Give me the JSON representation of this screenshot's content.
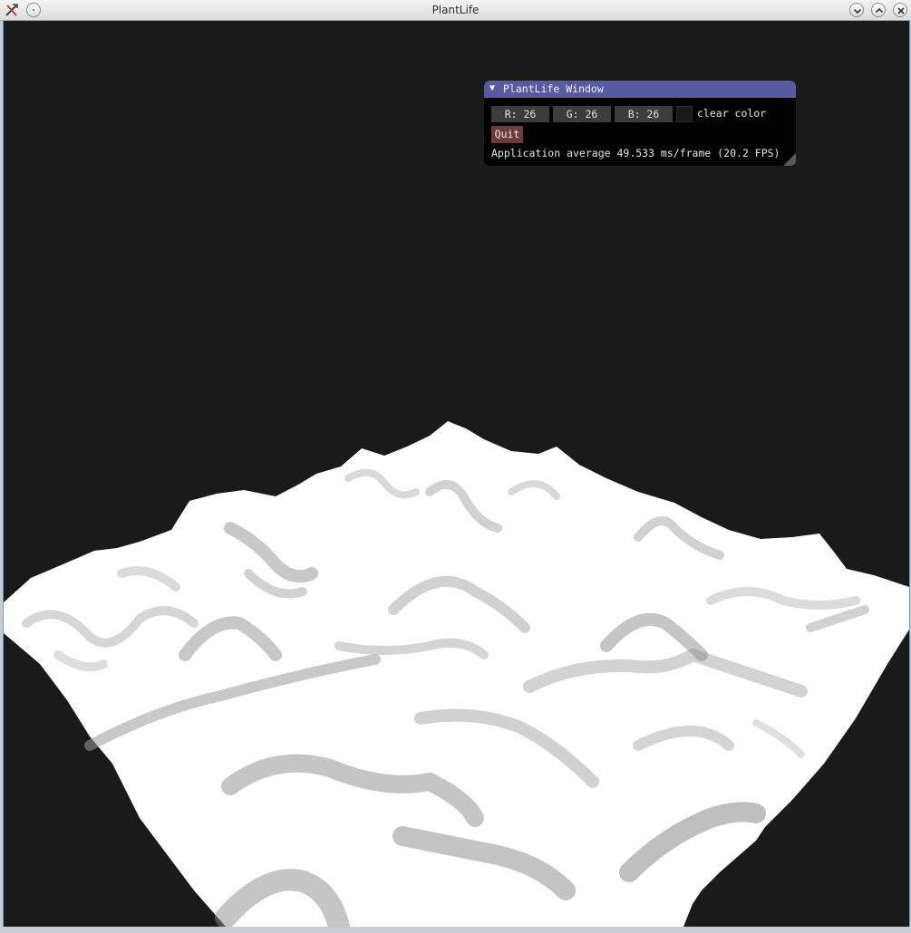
{
  "window": {
    "title": "PlantLife",
    "icons": [
      "app-icon",
      "pin-icon",
      "minimize-icon",
      "maximize-icon",
      "close-icon"
    ]
  },
  "viewport": {
    "background": "#1a1a1a",
    "terrain_color": "#ffffff",
    "shade_color": "#8c8c8c"
  },
  "imgui": {
    "title": "PlantLife Window",
    "collapse_icon": "▼",
    "color_fields": {
      "r": "R: 26",
      "g": "G: 26",
      "b": "B: 26"
    },
    "swatch_color": "#1a1a1a",
    "clear_color_label": "clear color",
    "quit_label": "Quit",
    "fps_text": "Application average 49.533 ms/frame (20.2 FPS)",
    "title_bar_color": "#5a5aa0",
    "quit_color": "#6e3a3a"
  }
}
